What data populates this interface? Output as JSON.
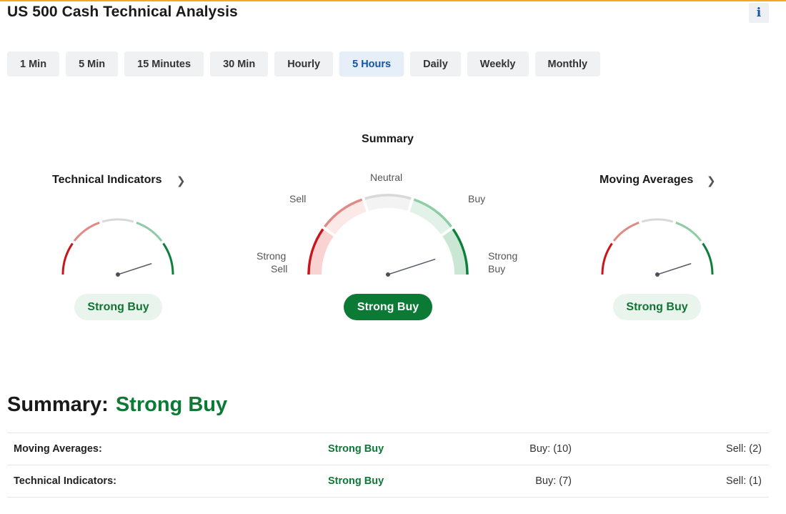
{
  "page": {
    "title": "US 500 Cash Technical Analysis",
    "info_label": "i"
  },
  "timeframes": {
    "active": "5 Hours",
    "items": [
      "1 Min",
      "5 Min",
      "15 Minutes",
      "30 Min",
      "Hourly",
      "5 Hours",
      "Daily",
      "Weekly",
      "Monthly"
    ]
  },
  "gauges": {
    "technical_indicators": {
      "title": "Technical Indicators",
      "result": "Strong Buy",
      "needle_level": "Strong Buy"
    },
    "summary": {
      "title": "Summary",
      "result": "Strong Buy",
      "needle_level": "Strong Buy",
      "labels": {
        "strong_sell_1": "Strong",
        "strong_sell_2": "Sell",
        "sell": "Sell",
        "neutral": "Neutral",
        "buy": "Buy",
        "strong_buy_1": "Strong",
        "strong_buy_2": "Buy"
      }
    },
    "moving_averages": {
      "title": "Moving Averages",
      "result": "Strong Buy",
      "needle_level": "Strong Buy"
    }
  },
  "summary": {
    "label": "Summary:",
    "value": "Strong Buy"
  },
  "table": {
    "rows": [
      {
        "name": "Moving Averages:",
        "signal": "Strong Buy",
        "buy": "Buy: (10)",
        "sell": "Sell: (2)"
      },
      {
        "name": "Technical Indicators:",
        "signal": "Strong Buy",
        "buy": "Buy: (7)",
        "sell": "Sell: (1)"
      }
    ]
  },
  "colors": {
    "accent_bar": "#f5a623",
    "strong_buy": "#0b7a35",
    "active_tab_text": "#1256a0",
    "strong_sell_arc": "#c8161d",
    "sell_arc": "#e08a86",
    "neutral_arc": "#d8d8d8",
    "buy_arc": "#8fcca6",
    "strong_buy_arc": "#0d7f3a"
  }
}
